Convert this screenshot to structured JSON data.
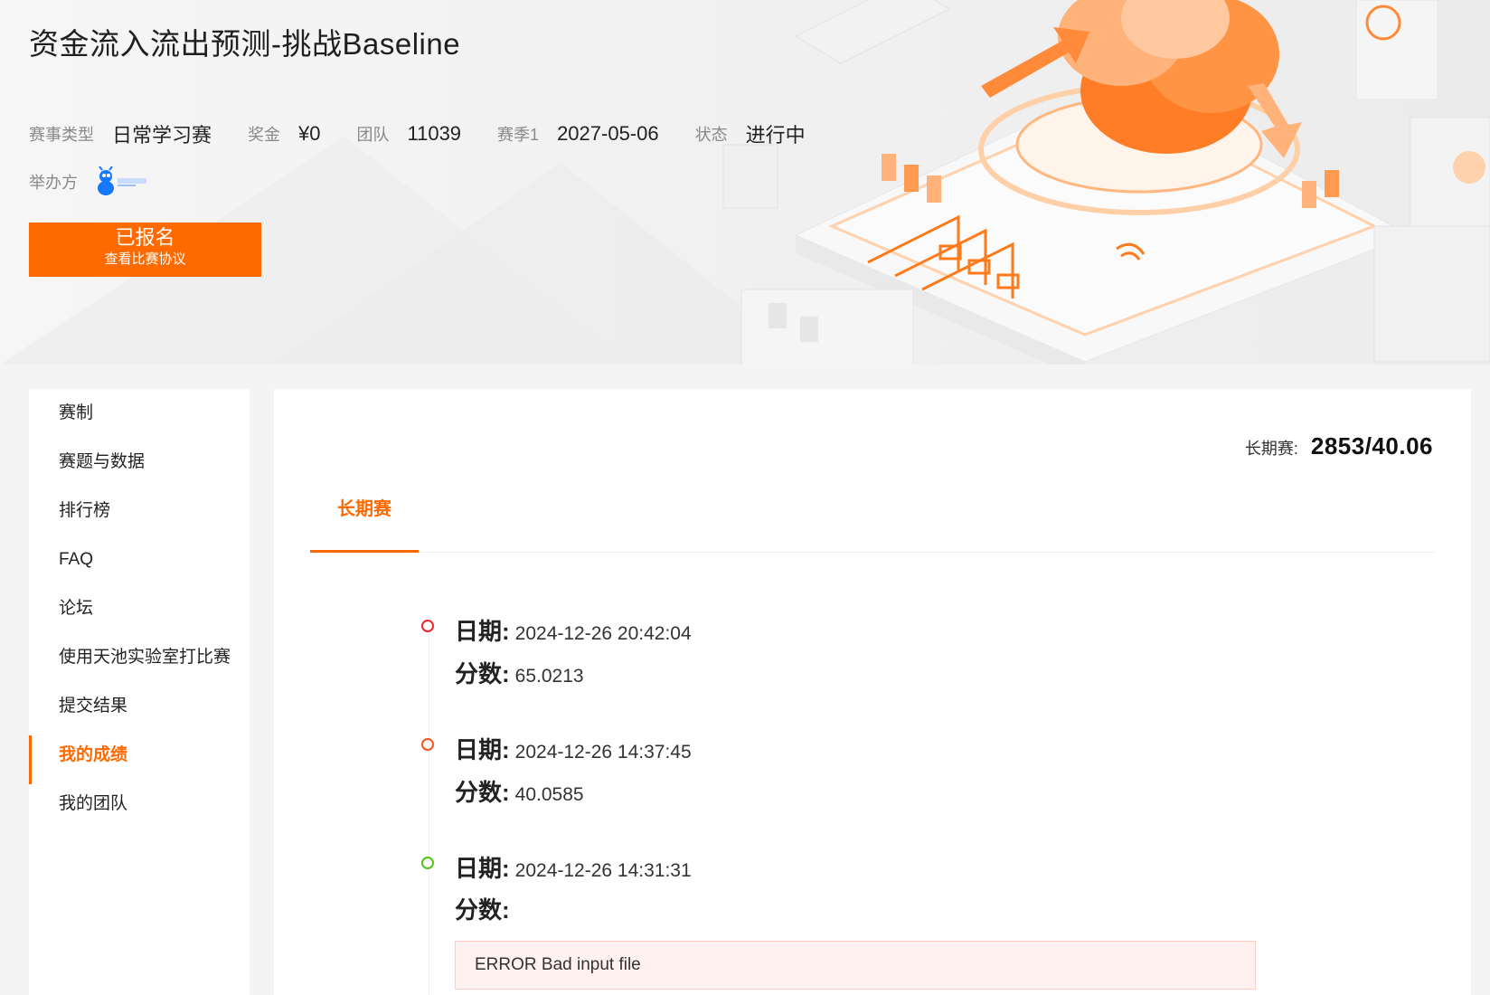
{
  "competition": {
    "title": "资金流入流出预测-挑战Baseline",
    "meta": [
      {
        "label": "赛事类型",
        "value": "日常学习赛"
      },
      {
        "label": "奖金",
        "value": "¥0"
      },
      {
        "label": "团队",
        "value": "11039"
      },
      {
        "label": "赛季1",
        "value": "2027-05-06"
      },
      {
        "label": "状态",
        "value": "进行中"
      }
    ],
    "host_label": "举办方",
    "host_logo_icon": "ant-financial-logo-icon",
    "signup_label": "已报名",
    "agreement_label": "查看比赛协议"
  },
  "sidebar": {
    "items": [
      {
        "label": "赛制"
      },
      {
        "label": "赛题与数据"
      },
      {
        "label": "排行榜"
      },
      {
        "label": "FAQ"
      },
      {
        "label": "论坛"
      },
      {
        "label": "使用天池实验室打比赛"
      },
      {
        "label": "提交结果"
      },
      {
        "label": "我的成绩",
        "active": true
      },
      {
        "label": "我的团队"
      }
    ]
  },
  "main": {
    "long_score_label": "长期赛:",
    "long_score_value": "2853/40.06",
    "tab_label": "长期赛",
    "date_key": "日期:",
    "score_key": "分数:",
    "submissions": [
      {
        "date": "2024-12-26 20:42:04",
        "score": "65.0213",
        "dot_color": "#f5222d"
      },
      {
        "date": "2024-12-26 14:37:45",
        "score": "40.0585",
        "dot_color": "#fa541c"
      },
      {
        "date": "2024-12-26 14:31:31",
        "score": "",
        "dot_color": "#52c41a",
        "error": "ERROR Bad input file"
      }
    ]
  },
  "colors": {
    "accent": "#ff6a00"
  }
}
